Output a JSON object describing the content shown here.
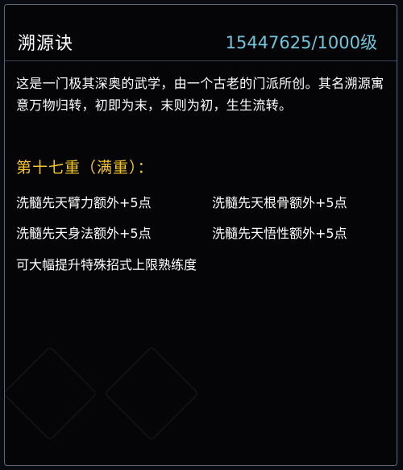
{
  "skill": {
    "name": "溯源诀",
    "level": "15447625/1000级",
    "description": "这是一门极其深奥的武学，由一个古老的门派所创。其名溯源寓意万物归转，初即为末，末则为初，生生流转。"
  },
  "tier": {
    "label": "第十七重（满重）："
  },
  "bonuses": [
    "洗髓先天臂力额外+5点",
    "洗髓先天根骨额外+5点",
    "洗髓先天身法额外+5点",
    "洗髓先天悟性额外+5点"
  ],
  "extra_effect": "可大幅提升特殊招式上限熟练度",
  "colors": {
    "title": "#ffffff",
    "level": "#71c4d9",
    "tier": "#f3c52c",
    "border": "#5b6a80"
  }
}
